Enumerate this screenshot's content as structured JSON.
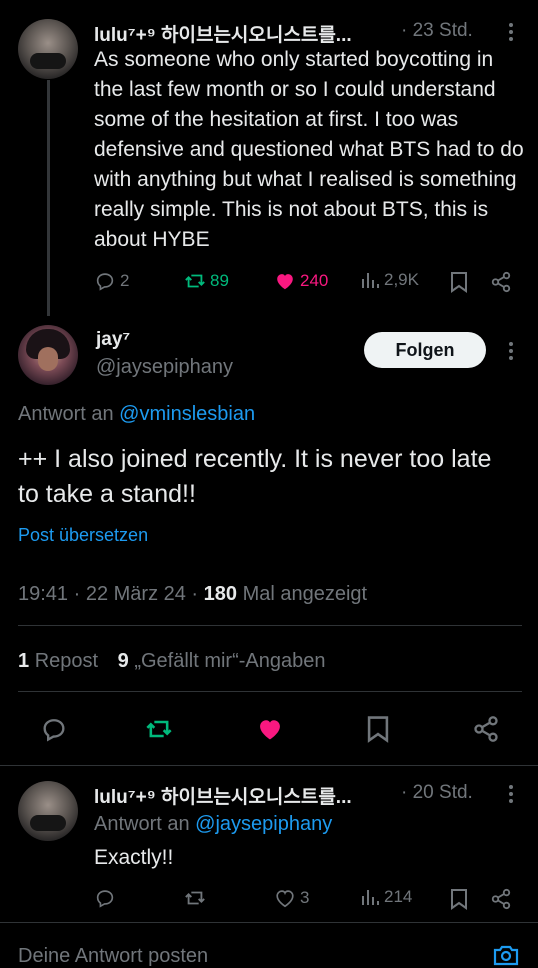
{
  "colors": {
    "bg": "#000000",
    "text": "#e7e9ea",
    "muted": "#71767b",
    "link": "#1d9bf0",
    "retweet": "#00ba7c",
    "like": "#f91880"
  },
  "tweet1": {
    "author": "lulu⁷+⁹ 하이브는시오니스트를...",
    "time": "· 23 Std.",
    "text": "As someone who only started boycotting in the last few month or so I could understand some of the hesitation at first. I too was defensive and questioned what BTS had to do with anything but what I realised is something really simple. This is not about BTS, this is about HYBE",
    "replies": "2",
    "reposts": "89",
    "likes": "240",
    "views": "2,9K"
  },
  "main": {
    "author": "jay⁷",
    "handle": "@jaysepiphany",
    "follow_label": "Folgen",
    "reply_to_prefix": "Antwort an",
    "reply_to": "@vminslesbian",
    "text": "++ I also joined recently. It is never too late to take a stand!!",
    "translate": "Post übersetzen",
    "timestamp": "19:41 · 22 März 24 ·",
    "views_count": "180",
    "views_label": "Mal angezeigt",
    "reposts_count": "1",
    "reposts_label": "Repost",
    "likes_count": "9",
    "likes_label": "„Gefällt mir“-Angaben"
  },
  "tweet2": {
    "author": "lulu⁷+⁹ 하이브는시오니스트를...",
    "time": "· 20 Std.",
    "reply_to_prefix": "Antwort an",
    "reply_to": "@jaysepiphany",
    "text": "Exactly!!",
    "likes": "3",
    "views": "214"
  },
  "reply_bar": {
    "placeholder": "Deine Antwort posten"
  }
}
